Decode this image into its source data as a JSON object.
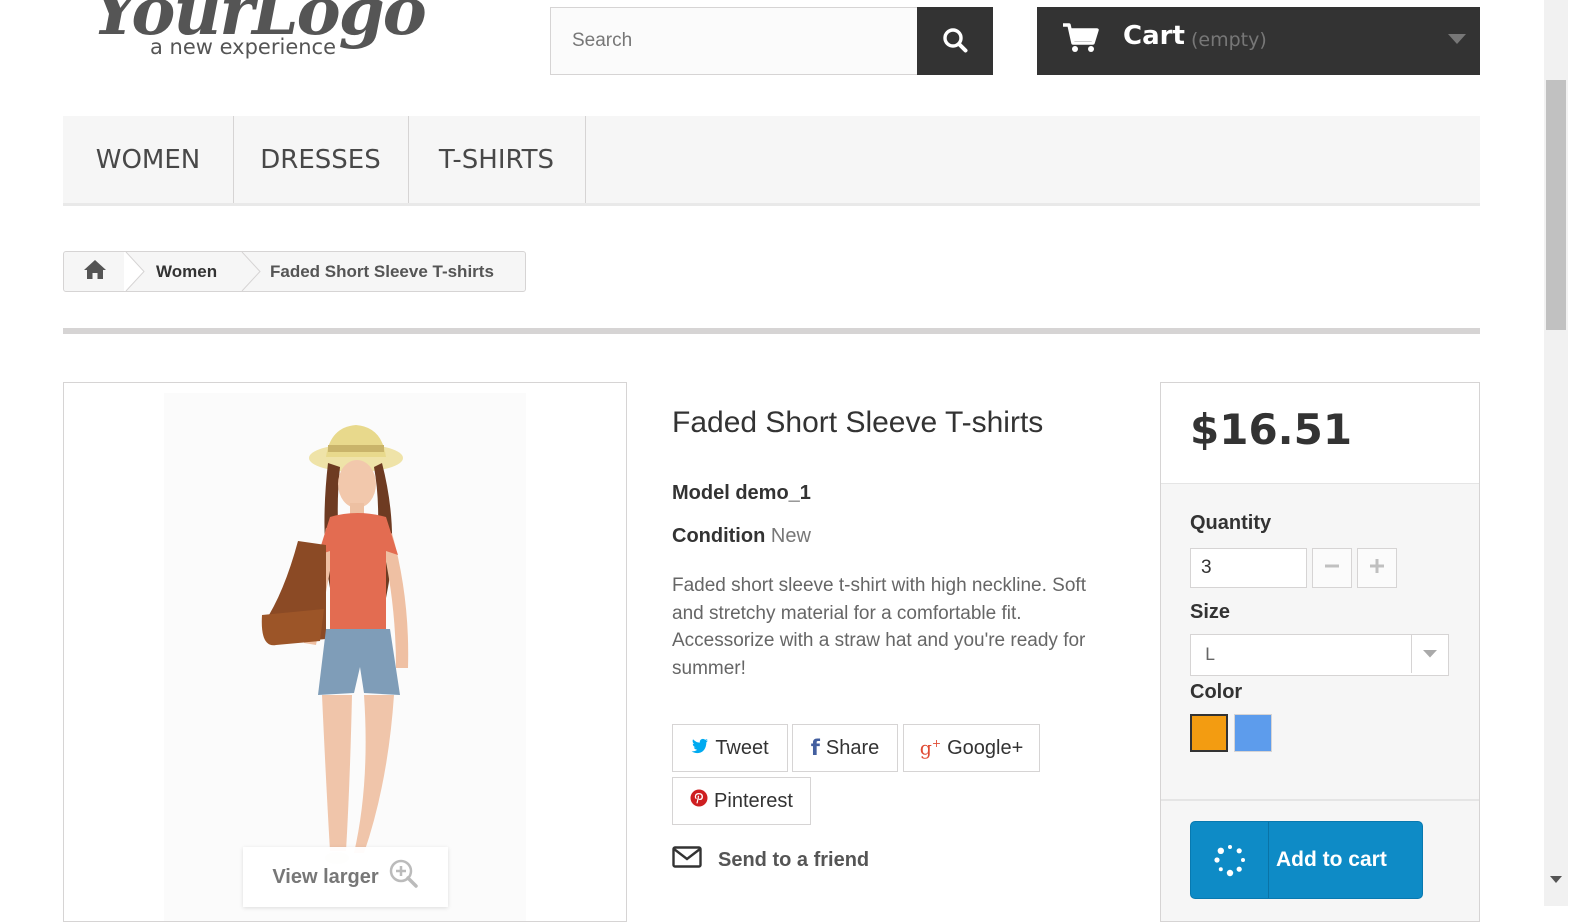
{
  "logo": {
    "script": "YourLogo",
    "tagline": "a new experience"
  },
  "search": {
    "placeholder": "Search",
    "icon": "search-icon"
  },
  "cart": {
    "label": "Cart",
    "status": "(empty)",
    "icon": "shopping-cart-icon"
  },
  "menu": {
    "items": [
      {
        "label": "WOMEN"
      },
      {
        "label": "DRESSES"
      },
      {
        "label": "T-SHIRTS"
      }
    ]
  },
  "breadcrumb": {
    "home_icon": "home-icon",
    "category": "Women",
    "current": "Faded Short Sleeve T-shirts"
  },
  "product": {
    "title": "Faded Short Sleeve T-shirts",
    "model_label": "Model",
    "model_value": "demo_1",
    "condition_label": "Condition",
    "condition_value": "New",
    "description": "Faded short sleeve t-shirt with high neckline. Soft and stretchy material for a comfortable fit. Accessorize with a straw hat and you're ready for summer!",
    "view_larger": "View larger"
  },
  "share": {
    "tweet": "Tweet",
    "facebook": "Share",
    "google": "Google+",
    "pinterest": "Pinterest",
    "send_friend": "Send to a friend"
  },
  "buy": {
    "price": "$16.51",
    "quantity_label": "Quantity",
    "quantity_value": "3",
    "size_label": "Size",
    "size_value": "L",
    "color_label": "Color",
    "colors": [
      "#f39c11",
      "#5d9cec"
    ],
    "add_to_cart": "Add to cart"
  },
  "colors": {
    "dark": "#333333",
    "accent_blue": "#0e8bc6",
    "twitter": "#00aaf0",
    "facebook": "#435f9f",
    "google": "#e04b34",
    "pinterest": "#ce1f21"
  }
}
